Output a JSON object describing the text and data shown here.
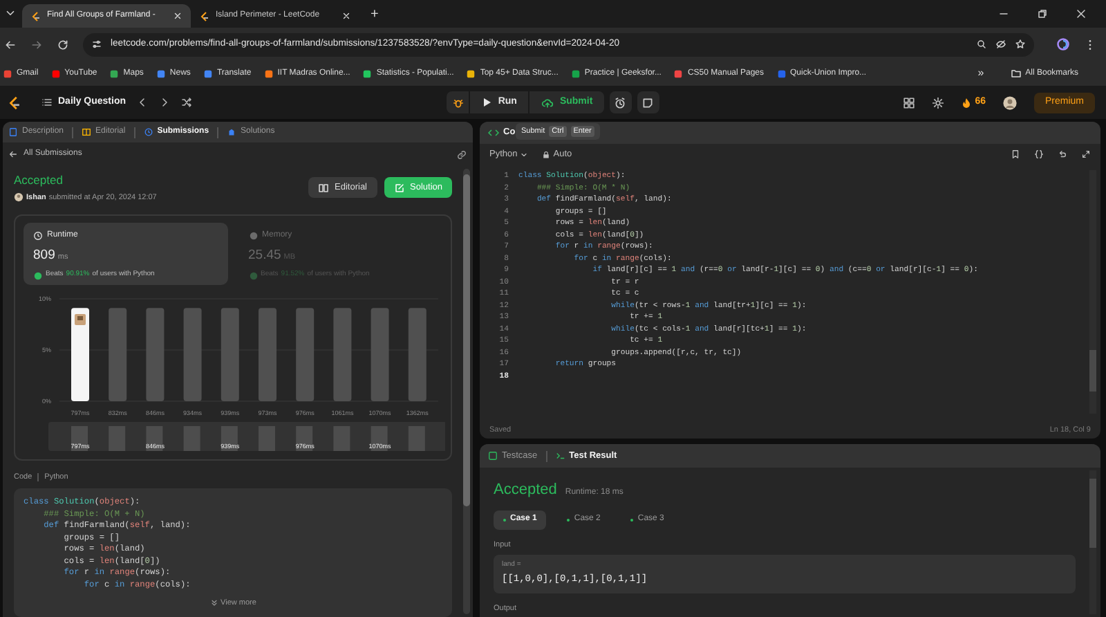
{
  "browser": {
    "tabs": [
      {
        "title": "Find All Groups of Farmland -",
        "selected": true
      },
      {
        "title": "Island Perimeter - LeetCode",
        "selected": false
      }
    ],
    "new_tab": "+",
    "url": "leetcode.com/problems/find-all-groups-of-farmland/submissions/1237583528/?envType=daily-question&envId=2024-04-20",
    "bookmarks": [
      "Gmail",
      "YouTube",
      "Maps",
      "News",
      "Translate",
      "IIT Madras Online...",
      "Statistics - Populati...",
      "Top 45+ Data Struc...",
      "Practice | Geeksfor...",
      "CS50 Manual Pages",
      "Quick-Union Impro..."
    ],
    "more_bookmarks": "»",
    "all_bookmarks": "All Bookmarks"
  },
  "toolbar": {
    "title": "Daily Question",
    "run": "Run",
    "submit": "Submit",
    "streak": "66",
    "premium": "Premium"
  },
  "left_panel": {
    "tabs": [
      {
        "label": "Description",
        "selected": false
      },
      {
        "label": "Editorial",
        "selected": false
      },
      {
        "label": "Submissions",
        "selected": true
      },
      {
        "label": "Solutions",
        "selected": false
      }
    ],
    "back_link": "All Submissions",
    "status": "Accepted",
    "user": "Ishan",
    "submitted": "submitted at Apr 20, 2024 12:07",
    "buttons": [
      "Editorial",
      "Solution"
    ],
    "metrics": [
      {
        "label": "Runtime",
        "value": "809",
        "unit": "ms",
        "beats_label": "Beats",
        "beats": "90.91%",
        "beats_suffix": "of users with Python",
        "selected": true
      },
      {
        "label": "Memory",
        "value": "25.45",
        "unit": "MB",
        "beats_label": "Beats",
        "beats": "91.52%",
        "beats_suffix": "of users with Python",
        "selected": false
      }
    ],
    "chart_data": {
      "type": "bar",
      "stacked": true,
      "categories": [
        "797ms",
        "832ms",
        "846ms",
        "934ms",
        "939ms",
        "973ms",
        "976ms",
        "1061ms",
        "1070ms",
        "1362ms"
      ],
      "series": [
        {
          "color": "#f5f5f5",
          "values": [
            9.1,
            null,
            null,
            null,
            null,
            null,
            null,
            null,
            null,
            null
          ]
        },
        {
          "color": "#505050",
          "values": [
            null,
            9.1,
            9.1,
            9.1,
            9.1,
            9.1,
            9.1,
            9.1,
            9.1,
            9.1
          ]
        }
      ],
      "ylim": [
        0,
        10
      ],
      "yticks": [
        {
          "value": 0,
          "label": "0%"
        },
        {
          "value": 5,
          "label": "5%"
        },
        {
          "value": 10,
          "label": "10%"
        }
      ]
    },
    "navigator_labels": [
      "797ms",
      "846ms",
      "939ms",
      "976ms",
      "1070ms"
    ],
    "code_label": "Code",
    "language": "Python",
    "code": [
      "class Solution(object):",
      "    ### Simple: O(M + N)",
      "    def findFarmland(self, land):",
      "        groups = []",
      "        rows = len(land)",
      "        cols = len(land[0])",
      "        for r in range(rows):",
      "            for c in range(cols):"
    ],
    "view_more": "View more"
  },
  "editor": {
    "tab": "Co",
    "tooltip": {
      "action": "Submit",
      "keys": [
        "Ctrl",
        "Enter"
      ]
    },
    "language": "Python",
    "mode": "Auto",
    "lines": [
      {
        "number": "1",
        "code": "class Solution(object):",
        "current": false
      },
      {
        "number": "2",
        "code": "    ### Simple: O(M * N)",
        "current": false
      },
      {
        "number": "3",
        "code": "    def findFarmland(self, land):",
        "current": false
      },
      {
        "number": "4",
        "code": "        groups = []",
        "current": false
      },
      {
        "number": "5",
        "code": "        rows = len(land)",
        "current": false
      },
      {
        "number": "6",
        "code": "        cols = len(land[0])",
        "current": false
      },
      {
        "number": "7",
        "code": "        for r in range(rows):",
        "current": false
      },
      {
        "number": "8",
        "code": "            for c in range(cols):",
        "current": false
      },
      {
        "number": "9",
        "code": "                if land[r][c] == 1 and (r==0 or land[r-1][c] == 0) and (c==0 or land[r][c-1] == 0):",
        "current": false
      },
      {
        "number": "10",
        "code": "                    tr = r",
        "current": false
      },
      {
        "number": "11",
        "code": "                    tc = c",
        "current": false
      },
      {
        "number": "12",
        "code": "                    while(tr < rows-1 and land[tr+1][c] == 1):",
        "current": false
      },
      {
        "number": "13",
        "code": "                        tr += 1",
        "current": false
      },
      {
        "number": "14",
        "code": "                    while(tc < cols-1 and land[r][tc+1] == 1):",
        "current": false
      },
      {
        "number": "15",
        "code": "                        tc += 1",
        "current": false
      },
      {
        "number": "16",
        "code": "                    groups.append([r,c, tr, tc])",
        "current": false
      },
      {
        "number": "17",
        "code": "        return groups",
        "current": false
      },
      {
        "number": "18",
        "current": true
      }
    ],
    "status": "Saved",
    "cursor": "Ln 18, Col 9"
  },
  "console": {
    "tabs": [
      {
        "label": "Testcase",
        "selected": false
      },
      {
        "label": "Test Result",
        "selected": true
      }
    ],
    "result": "Accepted",
    "runtime": "Runtime: 18 ms",
    "cases": [
      {
        "label": "Case 1",
        "selected": true,
        "passed": true
      },
      {
        "label": "Case 2",
        "selected": false,
        "passed": true
      },
      {
        "label": "Case 3",
        "selected": false,
        "passed": true
      }
    ],
    "input_label": "Input",
    "input_name": "land =",
    "input_value": "[[1,0,0],[0,1,1],[0,1,1]]",
    "output_label": "Output"
  }
}
